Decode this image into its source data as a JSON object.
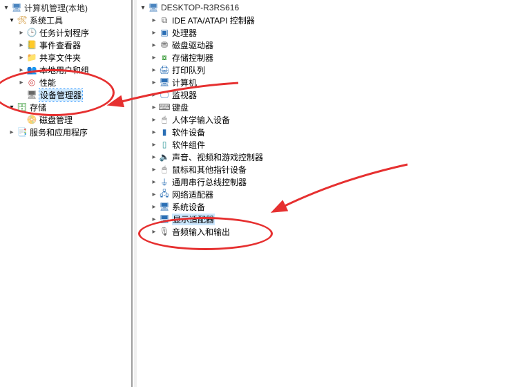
{
  "left_tree": {
    "root": {
      "label": "计算机管理(本地)",
      "expanded": true
    },
    "system_tools": {
      "label": "系统工具",
      "expanded": true
    },
    "task_scheduler": {
      "label": "任务计划程序"
    },
    "event_viewer": {
      "label": "事件查看器"
    },
    "shared_folders": {
      "label": "共享文件夹"
    },
    "local_users_groups": {
      "label": "本地用户和组"
    },
    "performance": {
      "label": "性能"
    },
    "device_manager": {
      "label": "设备管理器",
      "selected": true
    },
    "storage": {
      "label": "存储",
      "expanded": true
    },
    "disk_management": {
      "label": "磁盘管理"
    },
    "services_apps": {
      "label": "服务和应用程序"
    }
  },
  "right_tree": {
    "root": {
      "label": "DESKTOP-R3RS616",
      "expanded": true
    },
    "items": [
      {
        "key": "ide",
        "label": "IDE ATA/ATAPI 控制器",
        "icon": "ide-icon"
      },
      {
        "key": "cpu",
        "label": "处理器",
        "icon": "cpu-icon"
      },
      {
        "key": "disk-drive",
        "label": "磁盘驱动器",
        "icon": "disk-icon"
      },
      {
        "key": "storage-ctl",
        "label": "存储控制器",
        "icon": "storage-icon"
      },
      {
        "key": "print-queue",
        "label": "打印队列",
        "icon": "printer-icon"
      },
      {
        "key": "computer",
        "label": "计算机",
        "icon": "computer-icon"
      },
      {
        "key": "monitor",
        "label": "监视器",
        "icon": "monitor-icon"
      },
      {
        "key": "keyboard",
        "label": "键盘",
        "icon": "keyboard-icon"
      },
      {
        "key": "hid",
        "label": "人体学输入设备",
        "icon": "hid-icon"
      },
      {
        "key": "sw-dev",
        "label": "软件设备",
        "icon": "software-icon"
      },
      {
        "key": "sw-comp",
        "label": "软件组件",
        "icon": "sw-component-icon"
      },
      {
        "key": "sound",
        "label": "声音、视频和游戏控制器",
        "icon": "speaker-icon"
      },
      {
        "key": "mouse",
        "label": "鼠标和其他指针设备",
        "icon": "mouse-icon"
      },
      {
        "key": "usb",
        "label": "通用串行总线控制器",
        "icon": "usb-icon"
      },
      {
        "key": "network",
        "label": "网络适配器",
        "icon": "network-icon"
      },
      {
        "key": "system",
        "label": "系统设备",
        "icon": "system-icon"
      },
      {
        "key": "display",
        "label": "显示适配器",
        "icon": "display-icon",
        "highlight": true
      },
      {
        "key": "audio-io",
        "label": "音频输入和输出",
        "icon": "audio-icon"
      }
    ]
  },
  "annotation": {
    "ellipses": [
      "设备管理器",
      "显示适配器"
    ],
    "arrow_color": "#e63030"
  }
}
